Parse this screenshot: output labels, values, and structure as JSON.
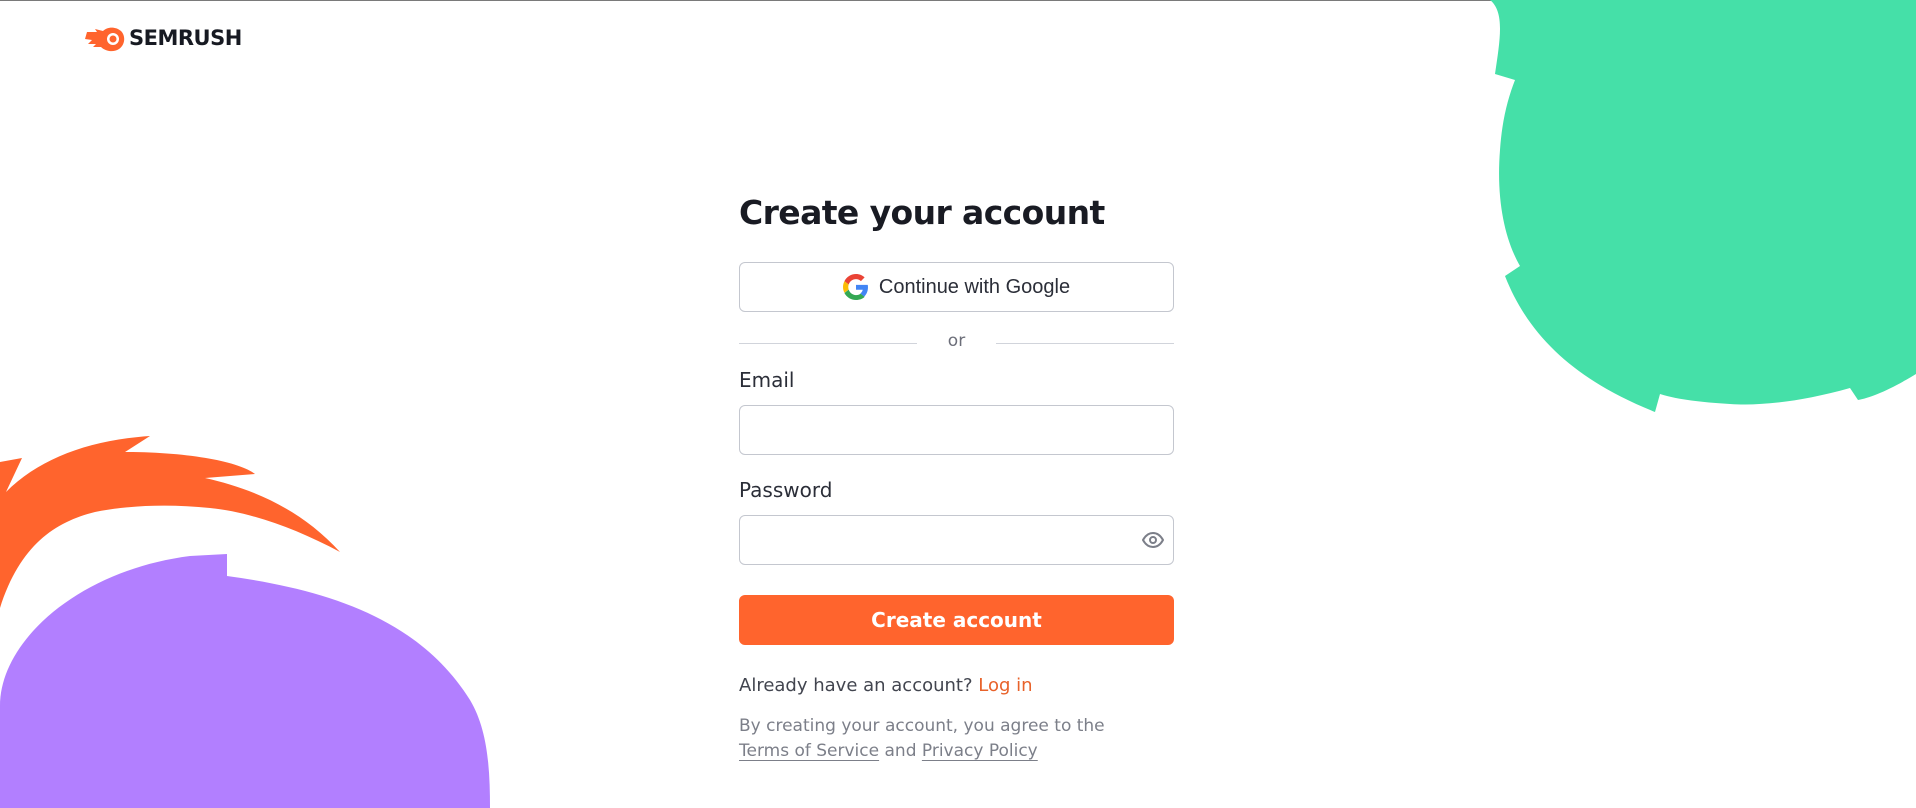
{
  "brand": {
    "name": "SEMRUSH",
    "colors": {
      "orange": "#ff642d",
      "green": "#45e0a8",
      "purple": "#b27fff",
      "text": "#191b23"
    }
  },
  "page": {
    "title": "Create your account"
  },
  "google": {
    "label": "Continue with Google",
    "icon": "google-g-icon"
  },
  "divider": {
    "text": "or"
  },
  "email": {
    "label": "Email",
    "value": "",
    "placeholder": ""
  },
  "password": {
    "label": "Password",
    "value": "",
    "placeholder": "",
    "toggle_icon": "eye-icon"
  },
  "submit": {
    "label": "Create account"
  },
  "login": {
    "prompt": "Already have an account?",
    "link": "Log in"
  },
  "legal": {
    "line1": "By creating your account, you agree to the",
    "terms": "Terms of Service",
    "and": "and",
    "privacy": "Privacy Policy"
  }
}
